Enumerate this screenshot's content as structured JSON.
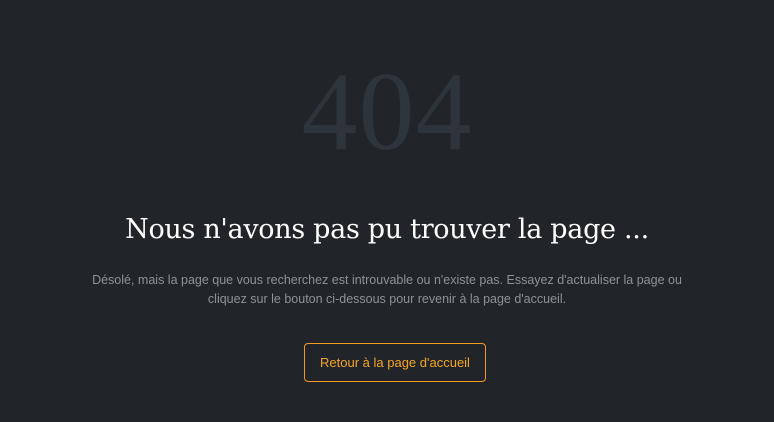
{
  "error": {
    "code": "404",
    "title": "Nous n'avons pas pu trouver la page ...",
    "description": "Désolé, mais la page que vous recherchez est introuvable ou n'existe pas. Essayez d'actualiser la page ou cliquez sur le bouton ci-dessous pour revenir à la page d'accueil.",
    "home_button_label": "Retour à la page d'accueil"
  },
  "colors": {
    "background": "#212429",
    "code": "#2d343b",
    "title": "#ffffff",
    "description": "#8e9297",
    "accent": "#f29a22"
  }
}
